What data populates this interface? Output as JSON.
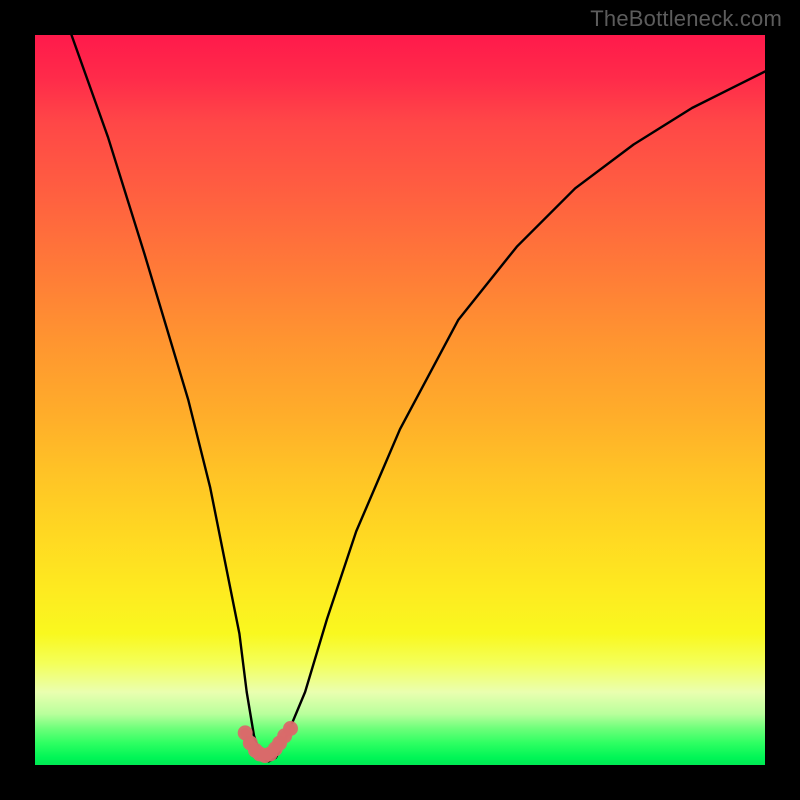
{
  "watermark": "TheBottleneck.com",
  "chart_data": {
    "type": "line",
    "title": "",
    "xlabel": "",
    "ylabel": "",
    "xlim": [
      0,
      100
    ],
    "ylim": [
      0,
      100
    ],
    "grid": false,
    "legend": false,
    "series": [
      {
        "name": "curve",
        "color": "#000000",
        "x": [
          5,
          10,
          15,
          18,
          21,
          24,
          26,
          28,
          29,
          30,
          31,
          32,
          33,
          34.5,
          37,
          40,
          44,
          50,
          58,
          66,
          74,
          82,
          90,
          96,
          100
        ],
        "values": [
          100,
          86,
          70,
          60,
          50,
          38,
          28,
          18,
          10,
          4,
          1,
          0.5,
          1,
          4,
          10,
          20,
          32,
          46,
          61,
          71,
          79,
          85,
          90,
          93,
          95
        ]
      },
      {
        "name": "seam-markers",
        "color": "#d96a6a",
        "marker": "circle",
        "x": [
          28.8,
          29.5,
          30.2,
          30.8,
          31.5,
          32.2,
          32.9,
          33.5,
          34.2,
          35.0
        ],
        "values": [
          4.4,
          3.0,
          2.0,
          1.5,
          1.3,
          1.5,
          2.2,
          3.0,
          4.0,
          5.0
        ]
      }
    ],
    "gradient_stops": [
      {
        "pos": 0,
        "color": "#ff1a4b"
      },
      {
        "pos": 22,
        "color": "#ff6040"
      },
      {
        "pos": 52,
        "color": "#ffad2a"
      },
      {
        "pos": 76,
        "color": "#feea20"
      },
      {
        "pos": 90,
        "color": "#eaffb0"
      },
      {
        "pos": 97,
        "color": "#2eff62"
      },
      {
        "pos": 100,
        "color": "#00e853"
      }
    ]
  }
}
